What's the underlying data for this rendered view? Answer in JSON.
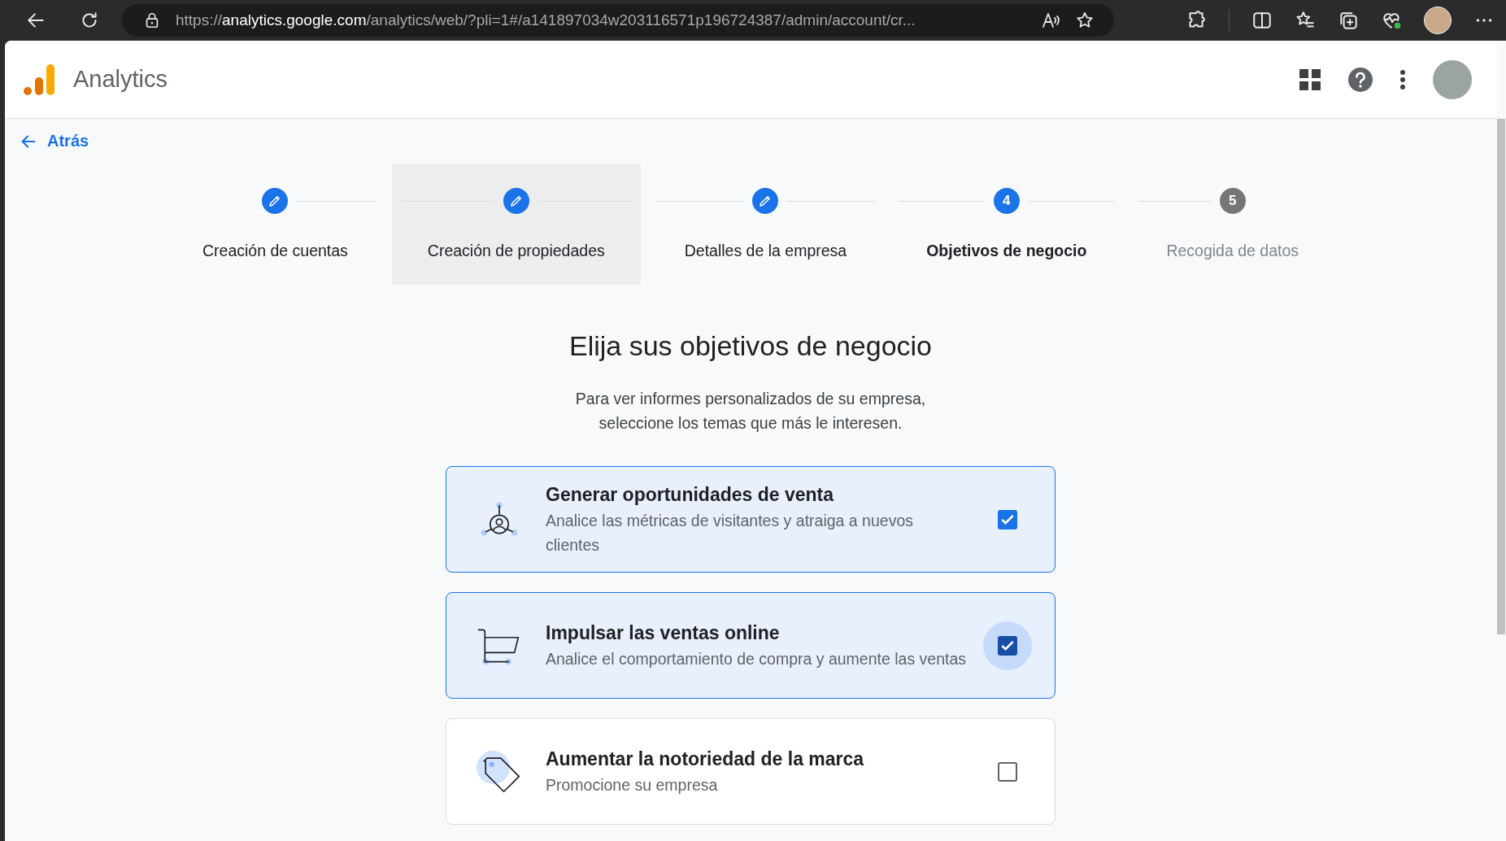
{
  "browser": {
    "url_scheme": "https://",
    "url_domain": "analytics.google.com",
    "url_path": "/analytics/web/?pli=1#/a141897034w203116571p196724387/admin/account/cr..."
  },
  "header": {
    "product": "Analytics"
  },
  "back_link": "Atrás",
  "steps": [
    {
      "label": "Creación de cuentas",
      "kind": "done",
      "hovered": false
    },
    {
      "label": "Creación de propiedades",
      "kind": "done",
      "hovered": true
    },
    {
      "label": "Detalles de la empresa",
      "kind": "done",
      "hovered": false
    },
    {
      "label": "Objetivos de negocio",
      "kind": "current",
      "number": "4",
      "hovered": false
    },
    {
      "label": "Recogida de datos",
      "kind": "pending",
      "number": "5",
      "hovered": false
    }
  ],
  "title": "Elija sus objetivos de negocio",
  "subtitle": [
    "Para ver informes personalizados de su empresa,",
    "seleccione los temas que más le interesen."
  ],
  "goals": [
    {
      "kind": "leads",
      "title": "Generar oportunidades de venta",
      "description": "Analice las métricas de visitantes y atraiga a nuevos clientes",
      "checked": true,
      "focused": false
    },
    {
      "kind": "sales",
      "title": "Impulsar las ventas online",
      "description": "Analice el comportamiento de compra y aumente las ventas",
      "checked": true,
      "focused": true
    },
    {
      "kind": "brand",
      "title": "Aumentar la notoriedad de la marca",
      "description": "Promocione su empresa",
      "checked": false,
      "focused": false
    }
  ]
}
